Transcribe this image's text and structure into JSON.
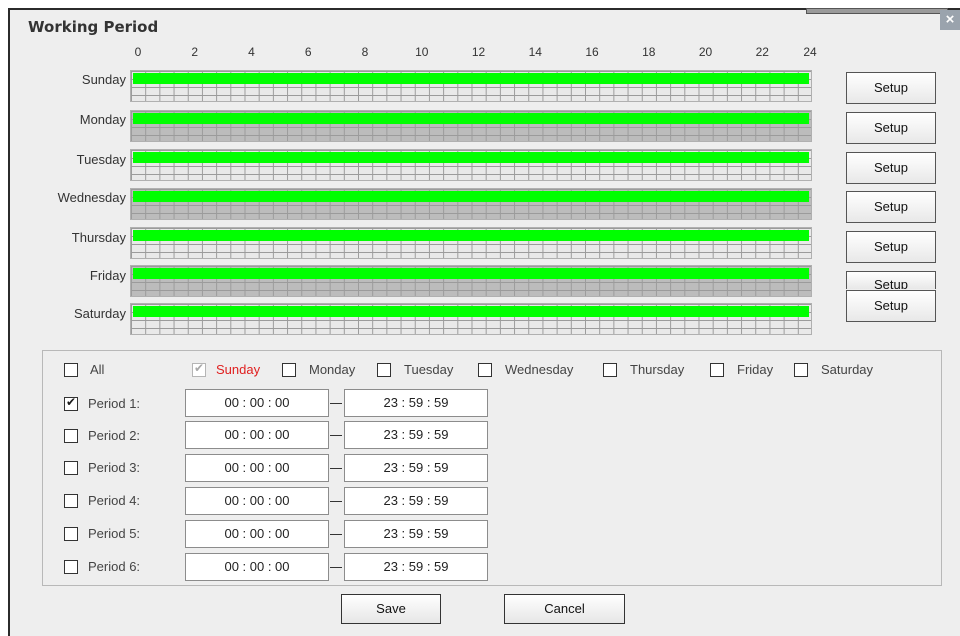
{
  "dialog": {
    "title": "Working Period",
    "close_glyph": "×"
  },
  "colors": {
    "active_bar": "#00ff00",
    "title_text": "#333333",
    "selected_day_text": "#e02020"
  },
  "hours": [
    "0",
    "2",
    "4",
    "6",
    "8",
    "10",
    "12",
    "14",
    "16",
    "18",
    "20",
    "22",
    "24"
  ],
  "days": [
    {
      "label": "Sunday",
      "setup": "Setup"
    },
    {
      "label": "Monday",
      "setup": "Setup"
    },
    {
      "label": "Tuesday",
      "setup": "Setup"
    },
    {
      "label": "Wednesday",
      "setup": "Setup"
    },
    {
      "label": "Thursday",
      "setup": "Setup"
    },
    {
      "label": "Friday",
      "setup": "Setup"
    },
    {
      "label": "Saturday",
      "setup": "Setup"
    }
  ],
  "schedule": {
    "active_fraction": 1.0,
    "note_active_days": [
      "Sunday",
      "Monday",
      "Tuesday",
      "Wednesday",
      "Thursday",
      "Friday",
      "Saturday"
    ]
  },
  "day_filter": {
    "all": {
      "label": "All",
      "checked": false
    },
    "items": [
      {
        "label": "Sunday",
        "checked": true,
        "disabled": true
      },
      {
        "label": "Monday",
        "checked": false
      },
      {
        "label": "Tuesday",
        "checked": false
      },
      {
        "label": "Wednesday",
        "checked": false
      },
      {
        "label": "Thursday",
        "checked": false
      },
      {
        "label": "Friday",
        "checked": false
      },
      {
        "label": "Saturday",
        "checked": false
      }
    ]
  },
  "periods": [
    {
      "label": "Period 1:",
      "checked": true,
      "start": "00 : 00 : 00",
      "end": "23 : 59 : 59"
    },
    {
      "label": "Period 2:",
      "checked": false,
      "start": "00 : 00 : 00",
      "end": "23 : 59 : 59"
    },
    {
      "label": "Period 3:",
      "checked": false,
      "start": "00 : 00 : 00",
      "end": "23 : 59 : 59"
    },
    {
      "label": "Period 4:",
      "checked": false,
      "start": "00 : 00 : 00",
      "end": "23 : 59 : 59"
    },
    {
      "label": "Period 5:",
      "checked": false,
      "start": "00 : 00 : 00",
      "end": "23 : 59 : 59"
    },
    {
      "label": "Period 6:",
      "checked": false,
      "start": "00 : 00 : 00",
      "end": "23 : 59 : 59"
    }
  ],
  "footer": {
    "save_label": "Save",
    "cancel_label": "Cancel"
  }
}
